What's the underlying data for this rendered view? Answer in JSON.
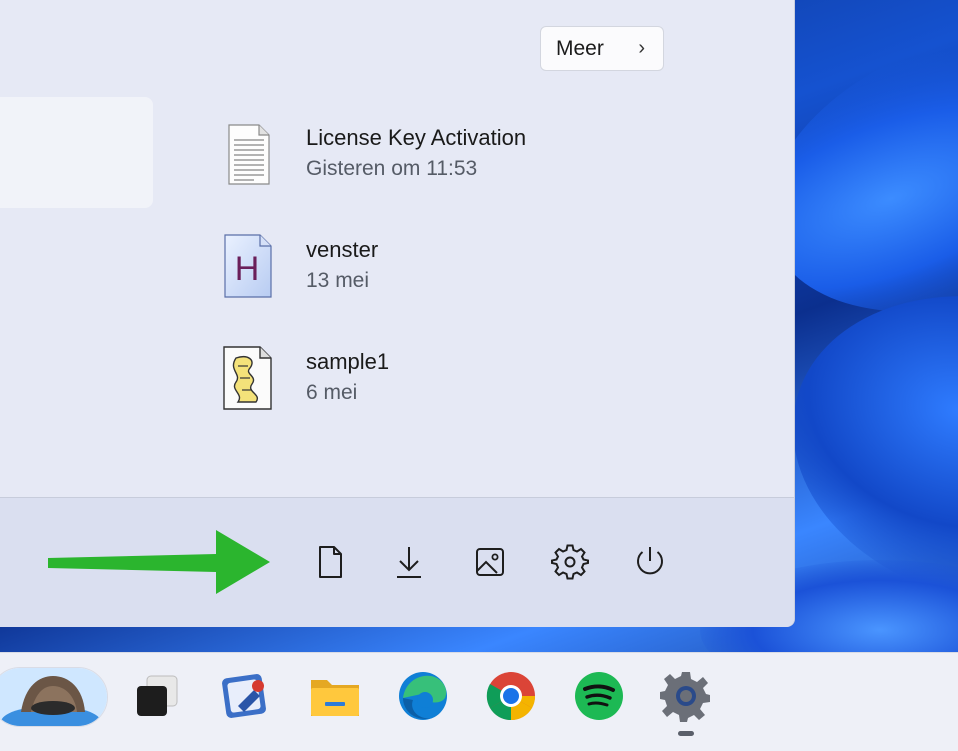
{
  "start_menu": {
    "more_label": "Meer",
    "more_chevron": "›",
    "recommended": [
      {
        "name": "License Key Activation",
        "date": "Gisteren om 11:53",
        "icon": "text-document-icon"
      },
      {
        "name": "venster",
        "date": "13 mei",
        "icon": "html-help-file-icon"
      },
      {
        "name": "sample1",
        "date": "6 mei",
        "icon": "script-scroll-file-icon"
      }
    ],
    "footer_icons": [
      "documents-icon",
      "downloads-icon",
      "pictures-icon",
      "settings-icon",
      "power-icon"
    ]
  },
  "annotation": {
    "arrow_color": "#2bb52e"
  },
  "taskbar": {
    "apps": [
      "search-widget",
      "task-view",
      "photo-app",
      "file-explorer",
      "microsoft-edge",
      "google-chrome",
      "spotify",
      "settings"
    ]
  },
  "colors": {
    "menu_bg": "#e6e9f5",
    "footer_bg": "#dadff0",
    "taskbar_bg": "#eef0f7",
    "wallpaper": "#1552d0"
  }
}
